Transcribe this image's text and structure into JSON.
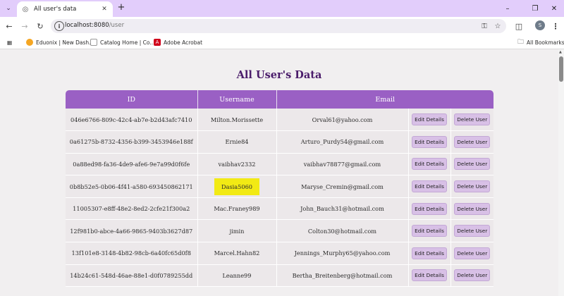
{
  "browser": {
    "tab_title": "All user's data",
    "url_host": "localhost:8080",
    "url_path": "/user",
    "profile_initial": "S",
    "bookmarks": [
      {
        "label": "Eduonix | New Dash..."
      },
      {
        "label": "Catalog Home | Co..."
      },
      {
        "label": "Adobe Acrobat"
      }
    ],
    "all_bookmarks": "All Bookmarks"
  },
  "page": {
    "title": "All User's Data",
    "columns": [
      "ID",
      "Username",
      "Email"
    ],
    "edit_label": "Edit Details",
    "delete_label": "Delete User",
    "rows": [
      {
        "id": "046e6766-809c-42c4-ab7e-b2d43afc7410",
        "username": "Milton.Morissette",
        "email": "Orval61@yahoo.com"
      },
      {
        "id": "0a61275b-8732-4356-b399-3453946e188f",
        "username": "Ernie84",
        "email": "Arturo_Purdy54@gmail.com"
      },
      {
        "id": "0a88ed98-fa36-4de9-afe6-9e7a99d0f6fe",
        "username": "vaibhav2332",
        "email": "vaibhav78877@gmail.com"
      },
      {
        "id": "0b8b52e5-0b06-4f41-a580-693450862171",
        "username": "Dasia5060",
        "email": "Maryse_Cremin@gmail.com",
        "highlighted": true
      },
      {
        "id": "11005307-e8ff-48e2-8ed2-2cfe21f300a2",
        "username": "Mac.Franey989",
        "email": "John_Bauch31@hotmail.com"
      },
      {
        "id": "12f981b0-abce-4a66-9865-9403b3627d87",
        "username": "jimin",
        "email": "Colton30@hotmail.com"
      },
      {
        "id": "13f101e8-3148-4b82-98cb-6a40fc65d0f8",
        "username": "Marcel.Hahn82",
        "email": "Jennings_Murphy65@yahoo.com"
      },
      {
        "id": "14b24c61-548d-46ae-88e1-d0f0789255dd",
        "username": "Leanne99",
        "email": "Bertha_Breitenberg@hotmail.com"
      }
    ]
  },
  "colors": {
    "header_purple": "#9a60c4",
    "title_purple": "#4b1d6b",
    "highlight_yellow": "#f2ea14",
    "tabstrip": "#e2cdfb"
  }
}
